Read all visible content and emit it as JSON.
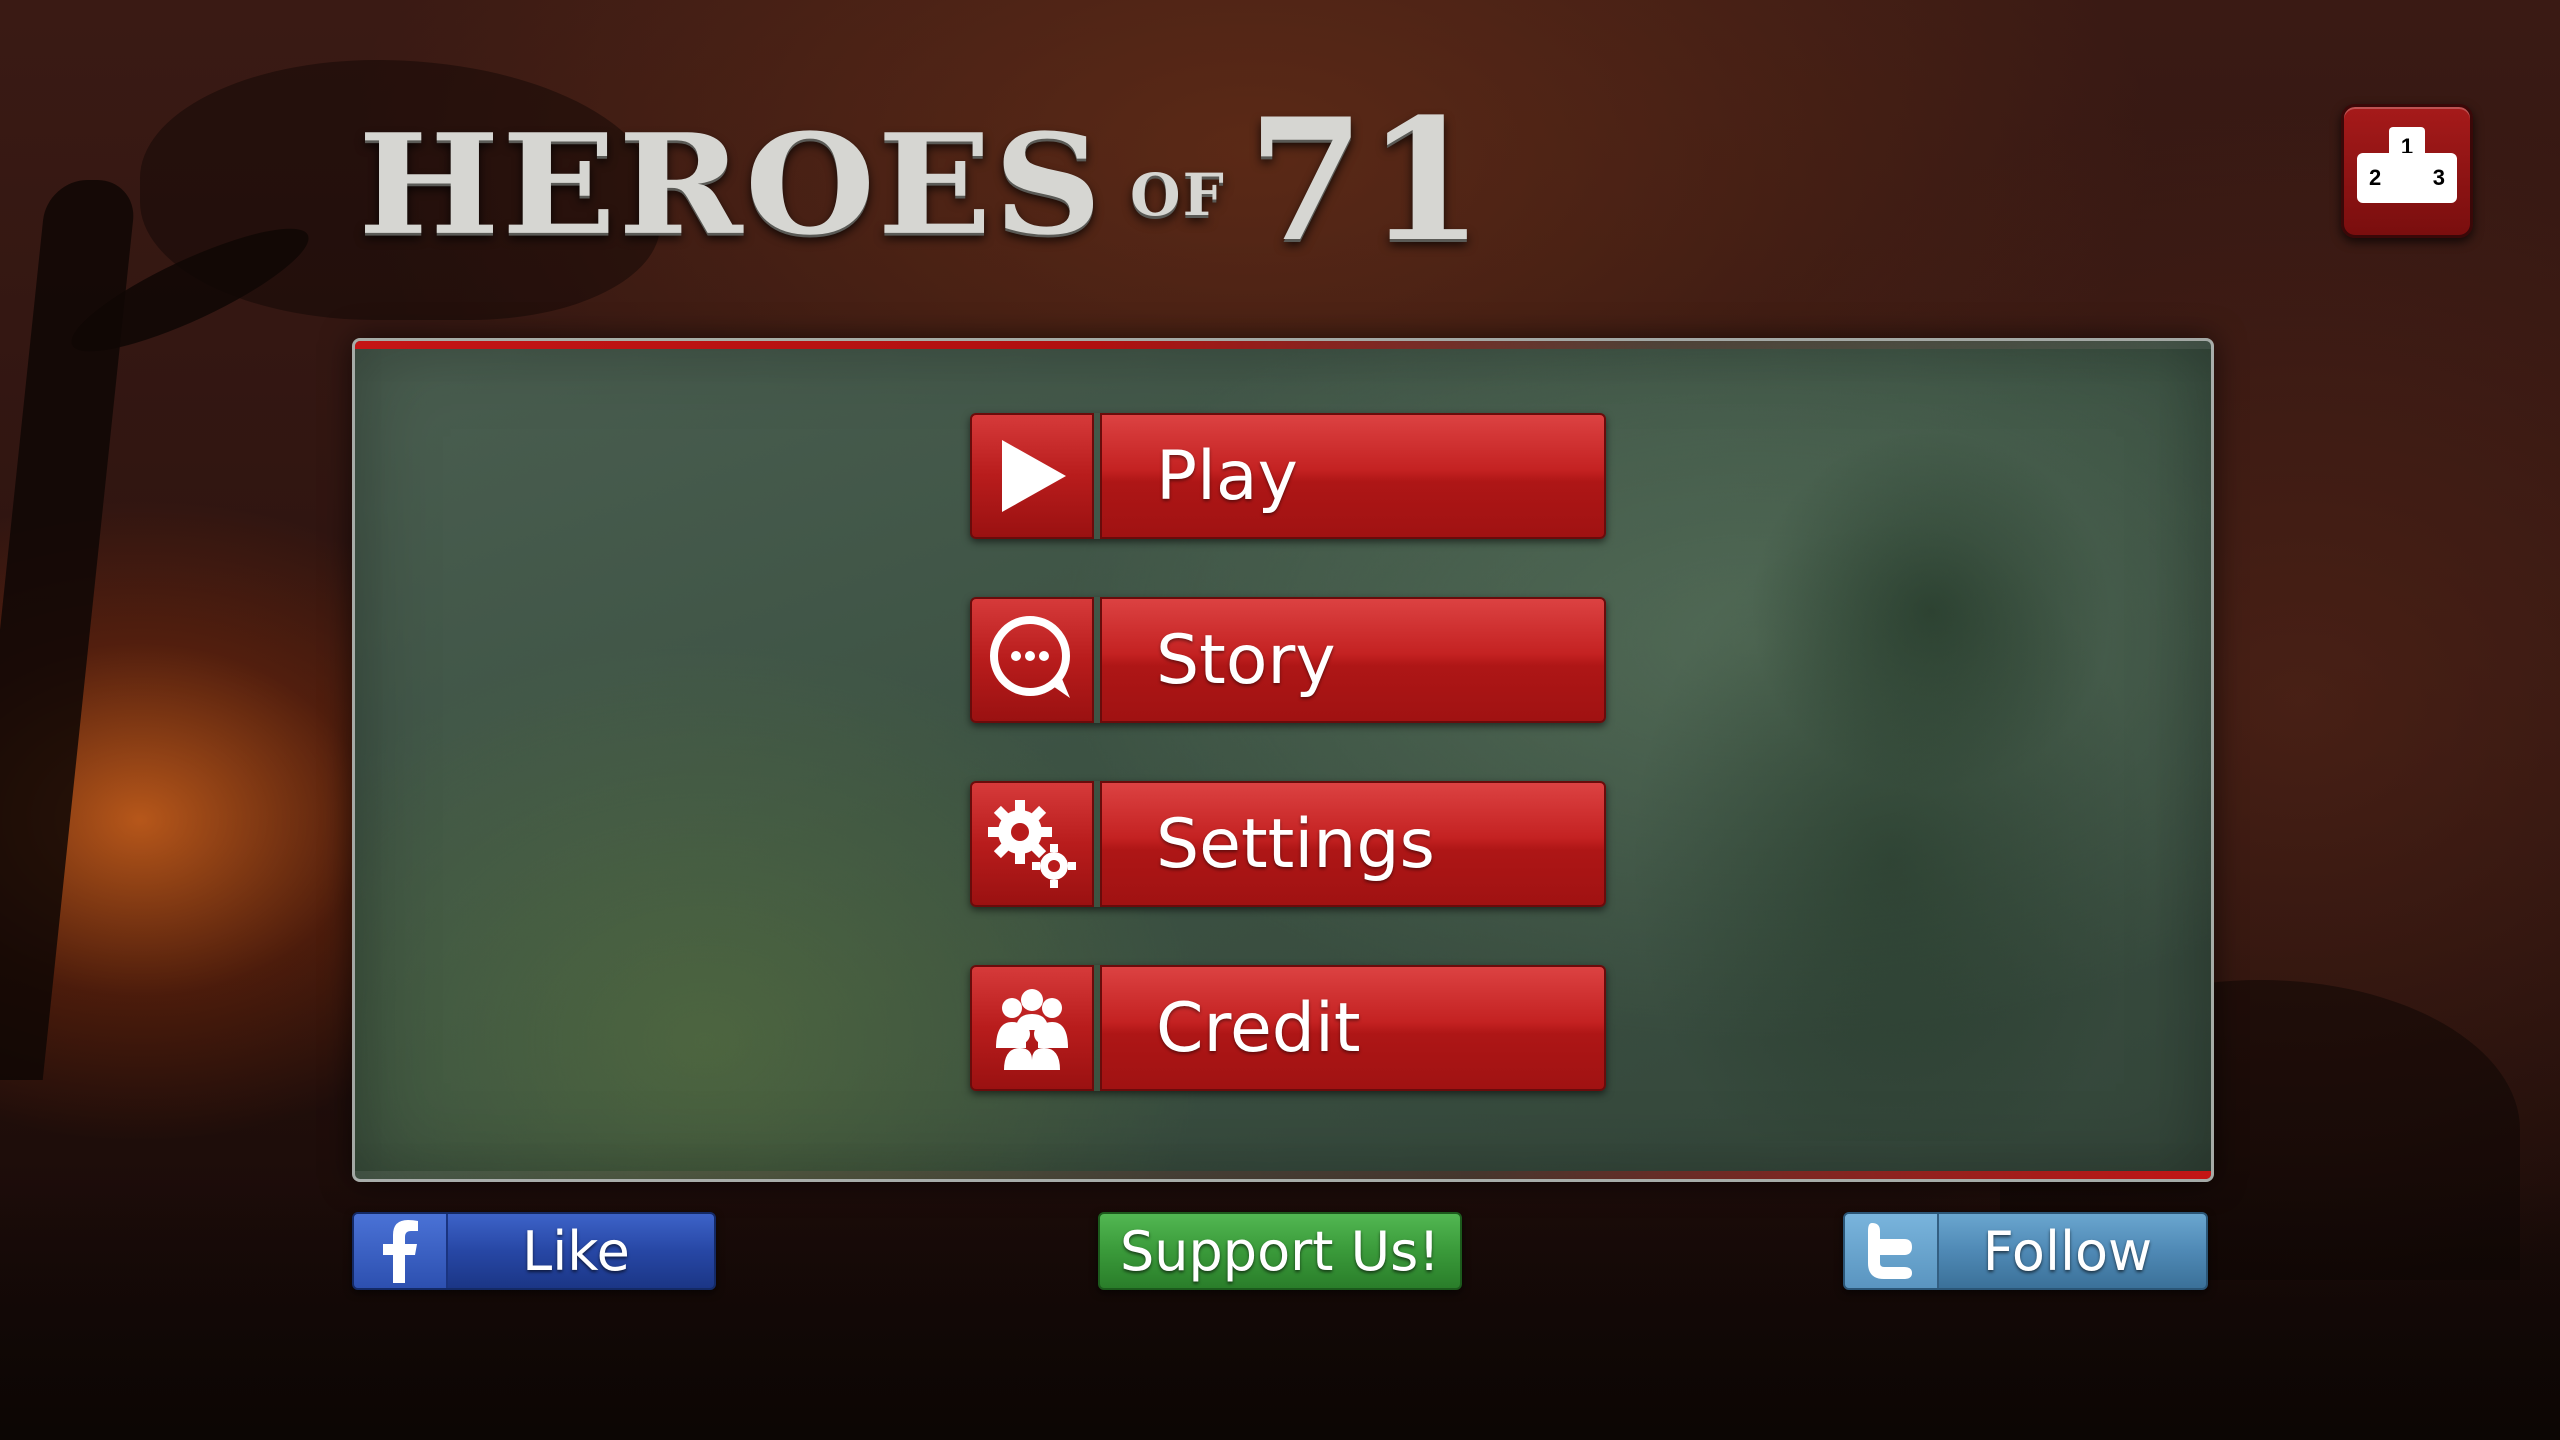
{
  "game": {
    "logo_main": "HEROES",
    "logo_of": "OF",
    "logo_number": "71"
  },
  "leaderboard": {
    "icon": "leaderboard-podium-icon",
    "rank_1": "1",
    "rank_2": "2",
    "rank_3": "3"
  },
  "menu": {
    "items": [
      {
        "label": "Play",
        "icon": "play-icon"
      },
      {
        "label": "Story",
        "icon": "chat-bubble-icon"
      },
      {
        "label": "Settings",
        "icon": "gears-icon"
      },
      {
        "label": "Credit",
        "icon": "people-group-icon"
      }
    ]
  },
  "social": {
    "like_label": "Like",
    "like_icon": "facebook-icon",
    "support_label": "Support Us!",
    "follow_label": "Follow",
    "follow_icon": "twitter-icon"
  },
  "colors": {
    "button_red": "#c42222",
    "facebook_blue": "#2747a5",
    "support_green": "#3a9a3a",
    "twitter_blue": "#4f89b5",
    "panel_green": "#3c5243"
  }
}
